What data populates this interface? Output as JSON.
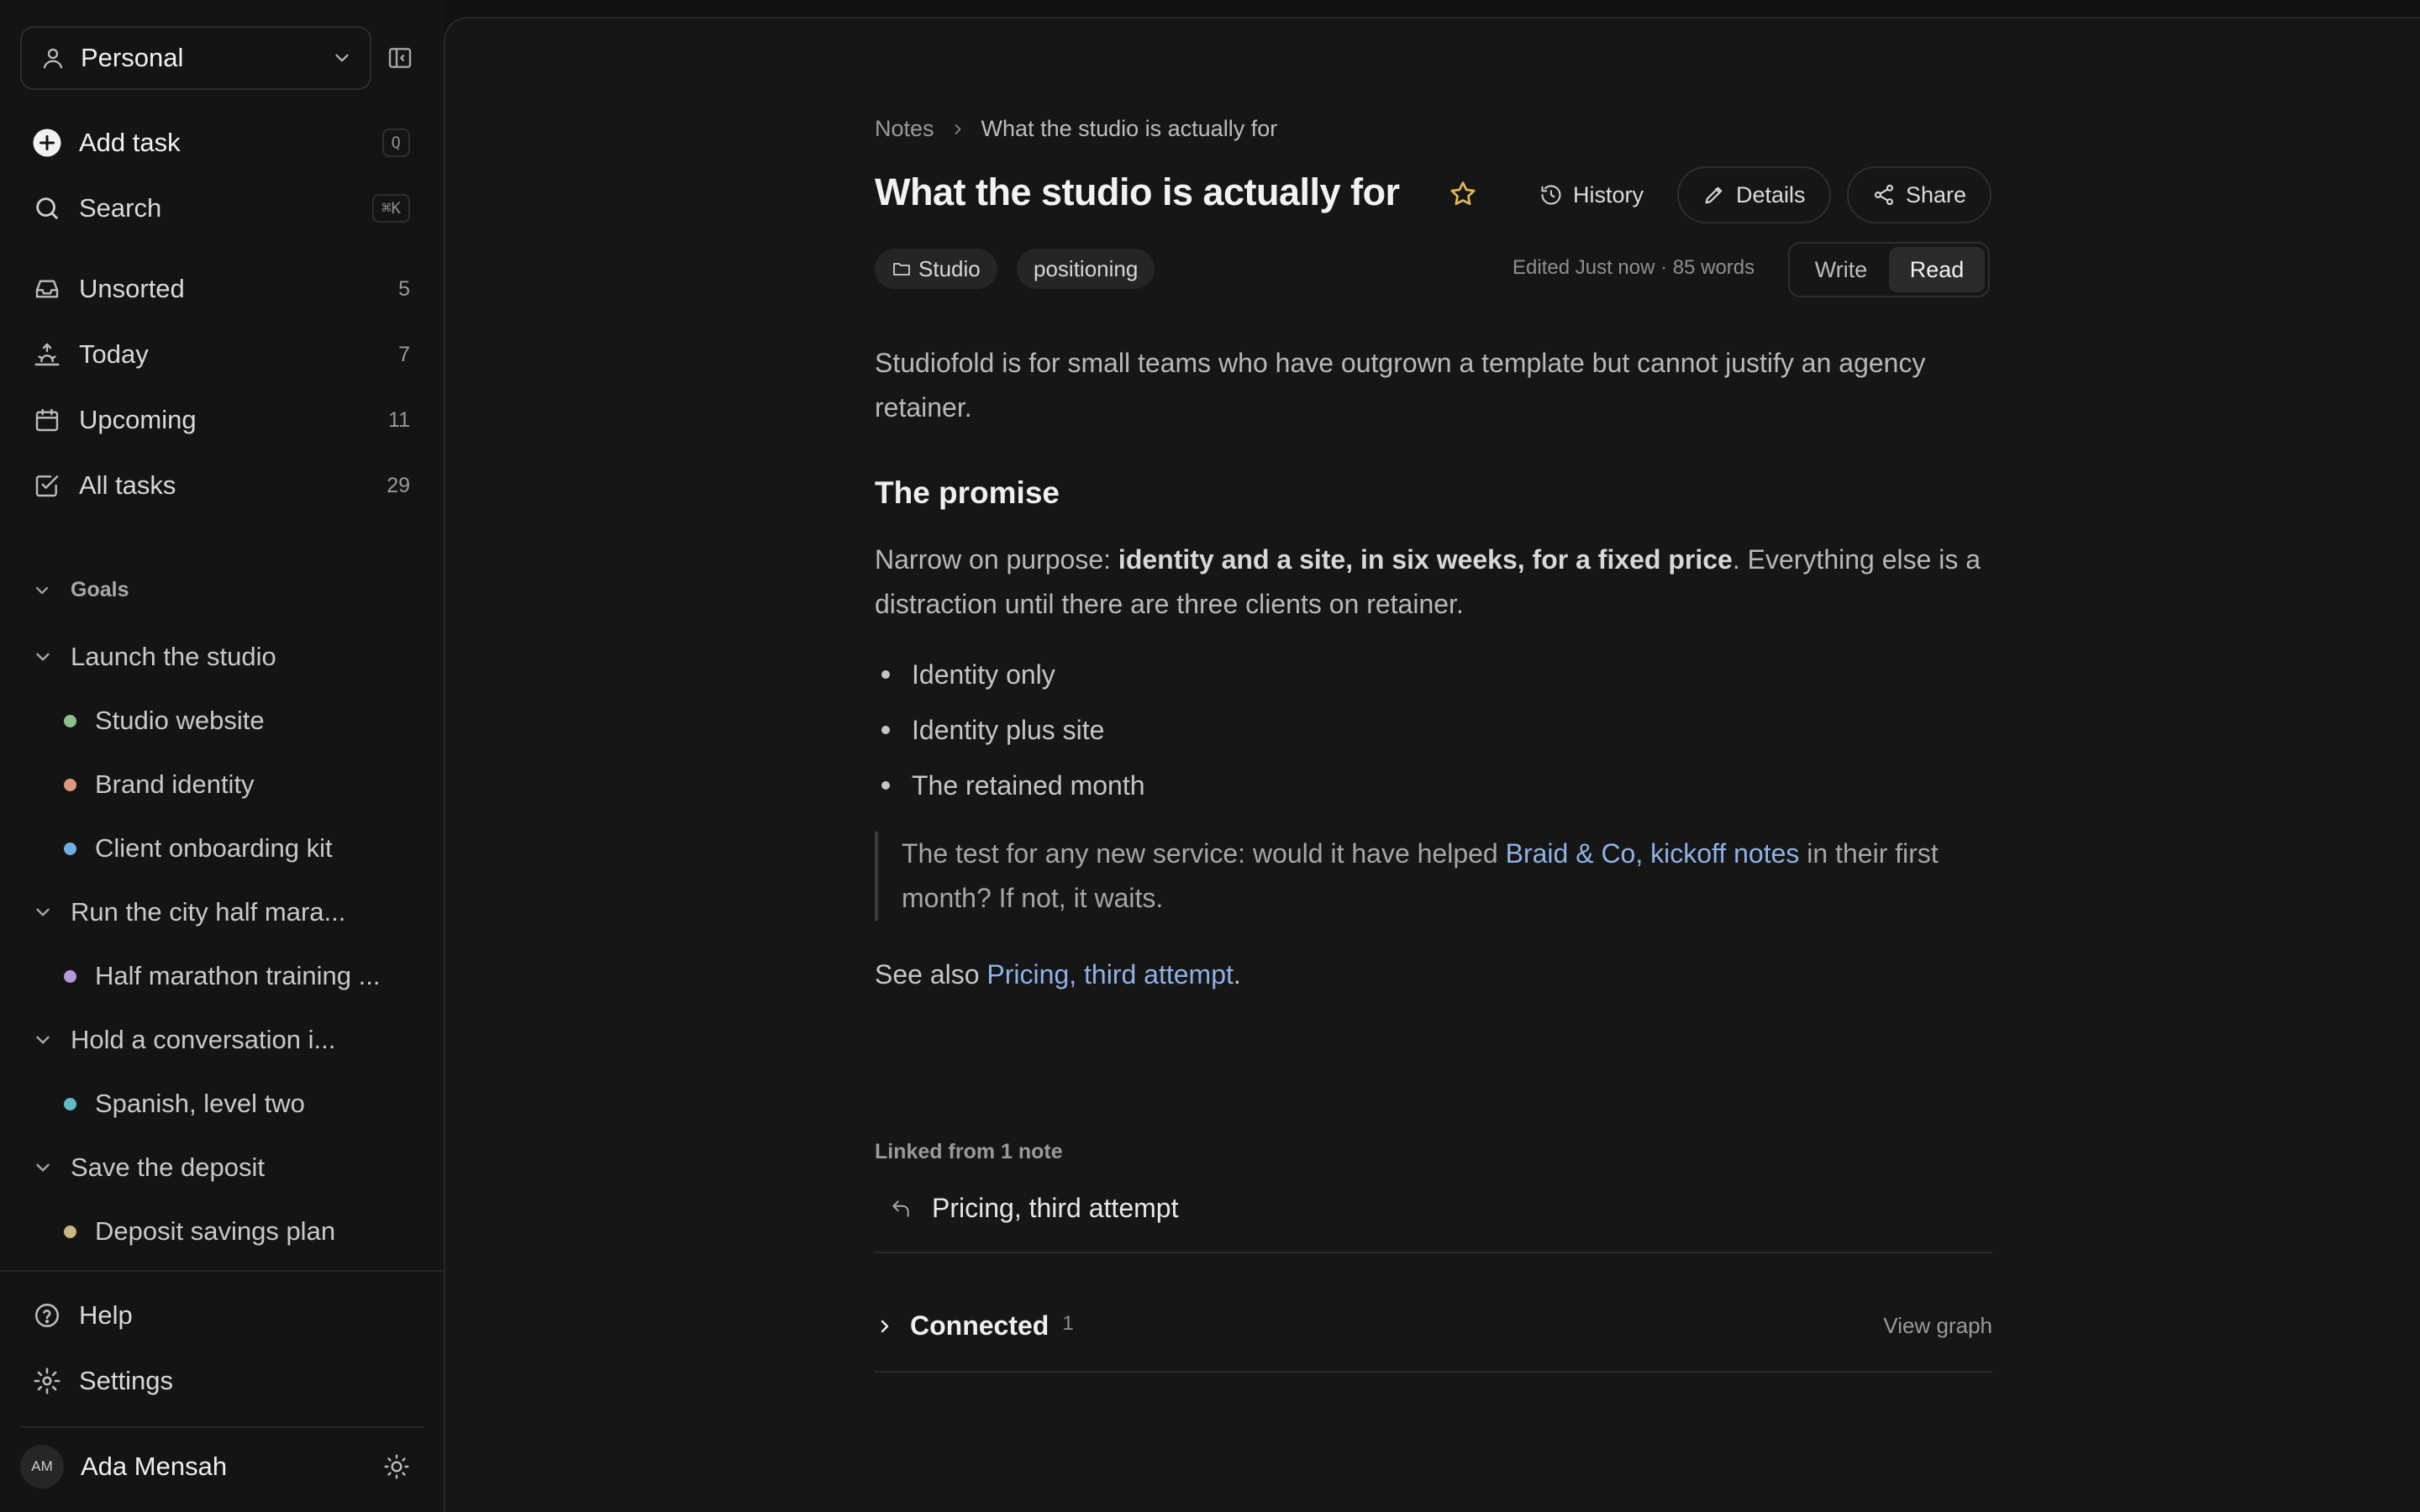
{
  "sidebar": {
    "workspace": "Personal",
    "add_task": "Add task",
    "add_task_shortcut": "Q",
    "search": "Search",
    "search_shortcut": "⌘K",
    "nav": [
      {
        "label": "Unsorted",
        "count": "5"
      },
      {
        "label": "Today",
        "count": "7"
      },
      {
        "label": "Upcoming",
        "count": "11"
      },
      {
        "label": "All tasks",
        "count": "29"
      }
    ],
    "goals_label": "Goals",
    "goals": [
      {
        "label": "Launch the studio",
        "items": [
          {
            "label": "Studio website",
            "color": "#8fbf8a"
          },
          {
            "label": "Brand identity",
            "color": "#d99a7f"
          },
          {
            "label": "Client onboarding kit",
            "color": "#6fb0e0"
          }
        ]
      },
      {
        "label": "Run the city half mara...",
        "items": [
          {
            "label": "Half marathon training ...",
            "color": "#b49ad9"
          }
        ]
      },
      {
        "label": "Hold a conversation i...",
        "items": [
          {
            "label": "Spanish, level two",
            "color": "#5fbcc6"
          }
        ]
      },
      {
        "label": "Save the deposit",
        "items": [
          {
            "label": "Deposit savings plan",
            "color": "#c7b883"
          }
        ]
      }
    ],
    "help": "Help",
    "settings": "Settings",
    "user": {
      "initials": "AM",
      "name": "Ada Mensah"
    }
  },
  "note": {
    "breadcrumb": {
      "root": "Notes",
      "current": "What the studio is actually for"
    },
    "title": "What the studio is actually for",
    "actions": {
      "history": "History",
      "details": "Details",
      "share": "Share"
    },
    "tags": {
      "folder": "Studio",
      "tag": "positioning"
    },
    "meta": "Edited Just now · 85 words",
    "modes": {
      "write": "Write",
      "read": "Read",
      "active": "Read"
    },
    "intro": "Studiofold is for small teams who have outgrown a template but cannot justify an agency retainer.",
    "heading": "The promise",
    "promise": {
      "prefix": "Narrow on purpose: ",
      "bold": "identity and a site, in six weeks, for a fixed price",
      "suffix": ". Everything else is a distraction until there are three clients on retainer."
    },
    "bullets": [
      "Identity only",
      "Identity plus site",
      "The retained month"
    ],
    "quote": {
      "prefix": "The test for any new service: would it have helped ",
      "link": "Braid & Co, kickoff notes",
      "suffix": " in their first month? If not, it waits."
    },
    "see_also": {
      "prefix": "See also ",
      "link": "Pricing, third attempt",
      "suffix": "."
    },
    "linked_from": "Linked from 1 note",
    "backlink": "Pricing, third attempt",
    "connected": {
      "label": "Connected",
      "count": "1",
      "view_graph": "View graph"
    }
  },
  "colors": {
    "accent_link": "#8fb2e6",
    "star": "#e3b55a",
    "background": "#111111"
  }
}
